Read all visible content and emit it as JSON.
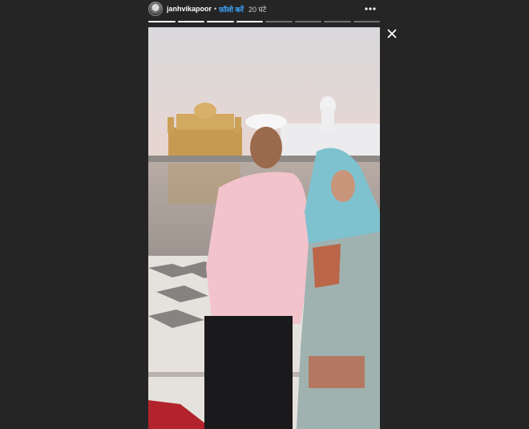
{
  "story": {
    "username": "janhvikapoor",
    "separator": "•",
    "follow_label": "फ़ॉलो करें",
    "time_label": "20 घंटे",
    "progress_total": 8,
    "progress_done": 4
  },
  "icons": {
    "more": "more-dots-icon",
    "close": "close-icon"
  },
  "colors": {
    "background": "#252526",
    "follow": "#3ea6ff",
    "progress_active": "#ffffff"
  }
}
